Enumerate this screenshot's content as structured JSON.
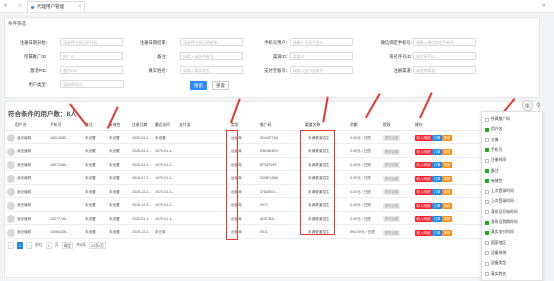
{
  "topbar": {
    "back": "«",
    "forward": "»",
    "home": "⌂",
    "tab_title": "代理用户管理",
    "tab_close": "×"
  },
  "filter": {
    "title": "条件筛选",
    "fields": [
      {
        "label": "注册日期开始：",
        "placeholder": "请选择注册日期开始"
      },
      {
        "label": "注册日期结束：",
        "placeholder": "请选择注册日期结束"
      },
      {
        "label": "手机号用户：",
        "placeholder": "请输入手机号用户"
      },
      {
        "label": "微信绑定手机号：",
        "placeholder": "请输入微信绑定手机号"
      },
      {
        "label": "所属推广ID：",
        "placeholder": "推广ID"
      },
      {
        "label": "备注：",
        "placeholder": "请输入或选择备注"
      },
      {
        "label": "渠道ID：",
        "placeholder": "渠道ID"
      },
      {
        "label": "排名序号ID：",
        "placeholder": "排名序号ID"
      },
      {
        "label": "激活PID：",
        "placeholder": "激活PID"
      },
      {
        "label": "真实姓名：",
        "placeholder": "请输入真实姓名"
      },
      {
        "label": "支付宝账号：",
        "placeholder": "请输入支付宝账号"
      },
      {
        "label": "注册渠道：",
        "placeholder": "请选择渠道"
      },
      {
        "label": "用户类型：",
        "placeholder": "请选择身份"
      }
    ],
    "search": "搜索",
    "reset": "重置"
  },
  "list": {
    "count_text": "符合条件的用户数：8人",
    "col_icon": "▥",
    "search_icon": "⚲",
    "headers": [
      "用户名",
      "手机号",
      "备注",
      "有效性",
      "注册日期",
      "最近访问",
      "支付宝",
      "类型",
      "推广码",
      "渠道名称",
      "余额",
      "提现",
      "操作"
    ],
    "rows": [
      {
        "name": "我无偏胖",
        "phone": "18014083...",
        "note": "未设置",
        "valid": "未设置",
        "reg": "2020-03-2...",
        "last": "未设置",
        "alipay": "",
        "type": "运营商",
        "code": "9D4OF76A",
        "channel": "未满渠道招生",
        "bal": "0.00元 / 已提",
        "wd": "提现设置"
      },
      {
        "name": "我无偏胖",
        "phone": "",
        "note": "未设置",
        "valid": "未设置",
        "reg": "2020-03-1...",
        "last": "1970-01-1...",
        "alipay": "",
        "type": "运营商",
        "code": "E6E6D4E9",
        "channel": "未满渠道招生",
        "bal": "0.00元 / 已提",
        "wd": "提现设置"
      },
      {
        "name": "我无偏胖",
        "phone": "18973160...",
        "note": "未设置",
        "valid": "未设置",
        "reg": "2020-03-1...",
        "last": "1970-01-1...",
        "alipay": "",
        "type": "运营商",
        "code": "EF52F2EF",
        "channel": "未满渠道招生",
        "bal": "0.00元 / 已提",
        "wd": "提现设置"
      },
      {
        "name": "我无偏胖",
        "phone": "",
        "note": "未设置",
        "valid": "未设置",
        "reg": "2019-07-2...",
        "last": "1970-01-1...",
        "alipay": "",
        "type": "运营商",
        "code": "D2DE1D80",
        "channel": "未满渠道招生",
        "bal": "0.00元 / 已提",
        "wd": "提现设置"
      },
      {
        "name": "我无偏胖",
        "phone": "",
        "note": "未设置",
        "valid": "未设置",
        "reg": "2019-12-2...",
        "last": "1970-01-1...",
        "alipay": "",
        "type": "运营商",
        "code": "3783EE0...",
        "channel": "未满渠道招生",
        "bal": "0.00元 / 已提",
        "wd": "提现设置"
      },
      {
        "name": "我无偏胖",
        "phone": "",
        "note": "未设置",
        "valid": "未设置",
        "reg": "2019-12-3...",
        "last": "1970-01-1...",
        "alipay": "",
        "type": "运营商",
        "code": "0071",
        "channel": "未满渠道招生",
        "bal": "0.00元 / 已提",
        "wd": "提现设置"
      },
      {
        "name": "我无偏胖",
        "phone": "13277746...",
        "note": "未设置",
        "valid": "未设置",
        "reg": "2020-01-1...",
        "last": "1970-01-1...",
        "alipay": "",
        "type": "运营商",
        "code": "AD57BA...",
        "channel": "未满渠道招生",
        "bal": "0.00元 / 已提",
        "wd": "提现设置"
      },
      {
        "name": "我无偏胖",
        "phone": "13084236...",
        "note": "未设置",
        "valid": "未设置",
        "reg": "2019-12-2...",
        "last": "未记录",
        "alipay": "",
        "type": "运营商",
        "code": "0011",
        "channel": "未满渠道招生",
        "bal": "990.00元 / 已提",
        "wd": "提现设置"
      }
    ],
    "actions": [
      "收入明细",
      "订单",
      "更新"
    ]
  },
  "columns_menu": [
    {
      "label": "所属推广码",
      "on": false
    },
    {
      "label": "用户名",
      "on": true
    },
    {
      "label": "头像",
      "on": false
    },
    {
      "label": "手机号",
      "on": true
    },
    {
      "label": "注册时间",
      "on": false
    },
    {
      "label": "备注",
      "on": true
    },
    {
      "label": "有效性",
      "on": true
    },
    {
      "label": "上次登录时间",
      "on": false
    },
    {
      "label": "上次登录时间",
      "on": false
    },
    {
      "label": "身份证开始时间",
      "on": false
    },
    {
      "label": "身份证到期时间",
      "on": true
    },
    {
      "label": "真实支付时间",
      "on": true
    },
    {
      "label": "国家地区",
      "on": false
    },
    {
      "label": "设备系统",
      "on": false
    },
    {
      "label": "设备类型",
      "on": false
    },
    {
      "label": "真实姓名",
      "on": false
    }
  ],
  "pager": {
    "prev": "‹",
    "page": "1",
    "next": "›",
    "goto": "前往",
    "page_input": "1",
    "page_unit": "页",
    "confirm": "确定",
    "total": "共8条",
    "size": "20条/页"
  },
  "colors": {
    "primary": "#2e8bff",
    "danger": "#f5222d",
    "warn": "#fa8c16",
    "check": "#1aad19"
  }
}
